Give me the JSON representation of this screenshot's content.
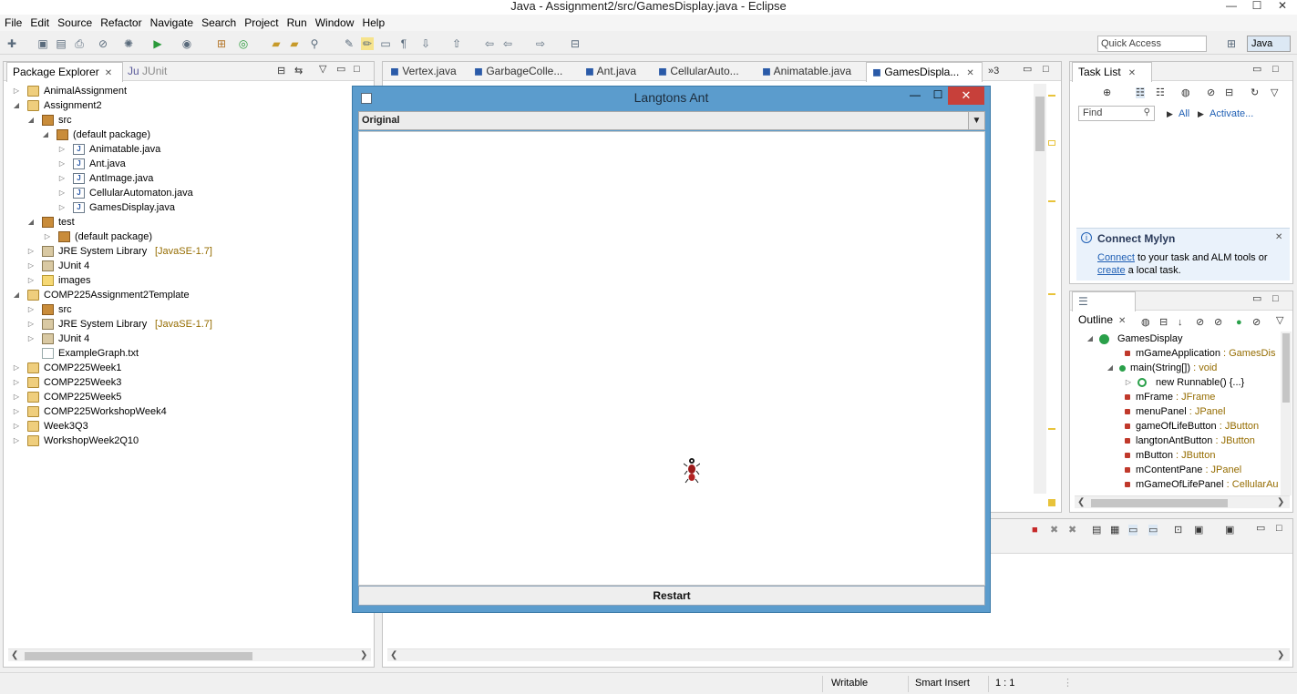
{
  "window": {
    "title": "Java - Assignment2/src/GamesDisplay.java - Eclipse",
    "min": "—",
    "max": "☐",
    "close": "✕"
  },
  "menu": [
    "File",
    "Edit",
    "Source",
    "Refactor",
    "Navigate",
    "Search",
    "Project",
    "Run",
    "Window",
    "Help"
  ],
  "toolbar": {
    "quick_access": "Quick Access",
    "perspective": "Java"
  },
  "package_explorer": {
    "tab": "Package Explorer",
    "junit_tab": "JUnit",
    "tree": [
      {
        "label": "AnimalAssignment"
      },
      {
        "label": "Assignment2"
      },
      {
        "label": "src"
      },
      {
        "label": "(default package)"
      },
      {
        "label": "Animatable.java"
      },
      {
        "label": "Ant.java"
      },
      {
        "label": "AntImage.java"
      },
      {
        "label": "CellularAutomaton.java"
      },
      {
        "label": "GamesDisplay.java"
      },
      {
        "label": "test"
      },
      {
        "label": "(default package)"
      },
      {
        "label": "JRE System Library",
        "decoration": "[JavaSE-1.7]"
      },
      {
        "label": "JUnit 4"
      },
      {
        "label": "images"
      },
      {
        "label": "COMP225Assignment2Template"
      },
      {
        "label": "src"
      },
      {
        "label": "JRE System Library",
        "decoration": "[JavaSE-1.7]"
      },
      {
        "label": "JUnit 4"
      },
      {
        "label": "ExampleGraph.txt"
      },
      {
        "label": "COMP225Week1"
      },
      {
        "label": "COMP225Week3"
      },
      {
        "label": "COMP225Week5"
      },
      {
        "label": "COMP225WorkshopWeek4"
      },
      {
        "label": "Week3Q3"
      },
      {
        "label": "WorkshopWeek2Q10"
      }
    ]
  },
  "editor_tabs": [
    "Vertex.java",
    "GarbageColle...",
    "Ant.java",
    "CellularAuto...",
    "Animatable.java",
    "GamesDispla..."
  ],
  "editor_overflow": "»3",
  "task_list": {
    "tab": "Task List",
    "find_placeholder": "Find",
    "all": "All",
    "activate": "Activate..."
  },
  "mylyn": {
    "title": "Connect Mylyn",
    "connect": "Connect",
    "text1": " to your task and ALM tools or",
    "create": "create",
    "text2": " a local task."
  },
  "outline": {
    "tab": "Outline",
    "items": [
      {
        "name": "GamesDisplay",
        "type": ""
      },
      {
        "name": "mGameApplication",
        "type": " : GamesDis"
      },
      {
        "name": "main(String[])",
        "type": " : void"
      },
      {
        "name": "new Runnable() {...}",
        "type": ""
      },
      {
        "name": "mFrame",
        "type": " : JFrame"
      },
      {
        "name": "menuPanel",
        "type": " : JPanel"
      },
      {
        "name": "gameOfLifeButton",
        "type": " : JButton"
      },
      {
        "name": "langtonAntButton",
        "type": " : JButton"
      },
      {
        "name": "mButton",
        "type": " : JButton"
      },
      {
        "name": "mContentPane",
        "type": " : JPanel"
      },
      {
        "name": "mGameOfLifePanel",
        "type": " : CellularAu"
      }
    ]
  },
  "dialog": {
    "title": "Langtons Ant",
    "combo_value": "Original",
    "restart": "Restart"
  },
  "status": {
    "writable": "Writable",
    "insert_mode": "Smart Insert",
    "position": "1 : 1"
  }
}
